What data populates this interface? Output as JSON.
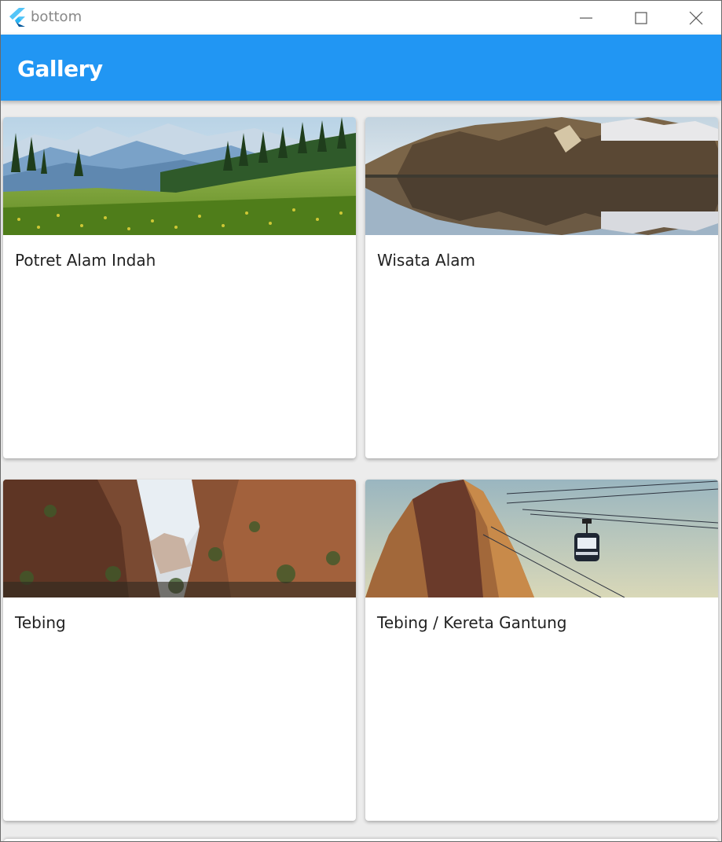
{
  "window": {
    "title": "bottom",
    "controls": [
      "minimize-icon",
      "maximize-icon",
      "close-icon"
    ]
  },
  "appbar": {
    "title": "Gallery",
    "color": "#2196f3"
  },
  "gallery": {
    "items": [
      {
        "title": "Potret Alam Indah",
        "image": "mountain-meadow-photo"
      },
      {
        "title": "Wisata Alam",
        "image": "lake-reflection-photo"
      },
      {
        "title": "Tebing",
        "image": "canyon-cliffs-photo"
      },
      {
        "title": "Tebing / Kereta Gantung",
        "image": "cable-car-cliff-photo"
      }
    ]
  }
}
